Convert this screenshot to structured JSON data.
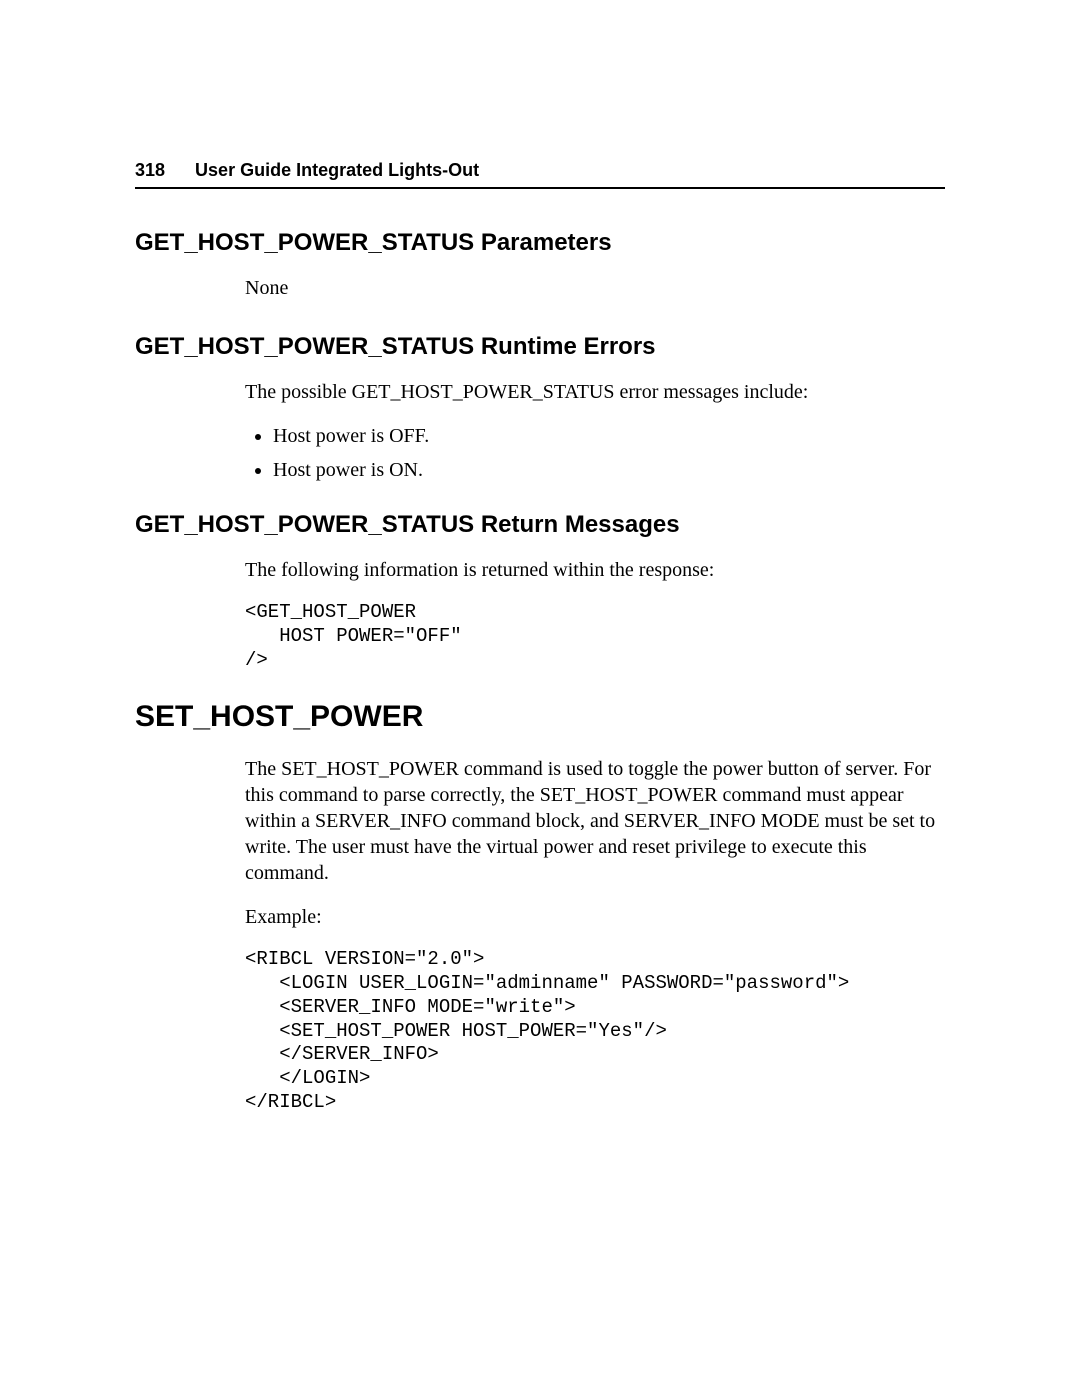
{
  "header": {
    "page_number": "318",
    "title": "User Guide Integrated Lights-Out"
  },
  "sections": {
    "params": {
      "heading": "GET_HOST_POWER_STATUS Parameters",
      "body": "None"
    },
    "runtime_errors": {
      "heading": "GET_HOST_POWER_STATUS Runtime Errors",
      "intro": "The possible GET_HOST_POWER_STATUS error messages include:",
      "items": [
        "Host power is OFF.",
        "Host power is ON."
      ]
    },
    "return_messages": {
      "heading": "GET_HOST_POWER_STATUS Return Messages",
      "intro": "The following information is returned within the response:",
      "code": "<GET_HOST_POWER\n   HOST POWER=\"OFF\"\n/>"
    },
    "set_host_power": {
      "heading": "SET_HOST_POWER",
      "body": "The SET_HOST_POWER command is used to toggle the power button of server. For this command to parse correctly, the SET_HOST_POWER command must appear within a SERVER_INFO command block, and SERVER_INFO MODE must be set to write. The user must have the virtual power and reset privilege to execute this command.",
      "example_label": "Example:",
      "code": "<RIBCL VERSION=\"2.0\">\n   <LOGIN USER_LOGIN=\"adminname\" PASSWORD=\"password\">\n   <SERVER_INFO MODE=\"write\">\n   <SET_HOST_POWER HOST_POWER=\"Yes\"/>\n   </SERVER_INFO>\n   </LOGIN>\n</RIBCL>"
    }
  }
}
